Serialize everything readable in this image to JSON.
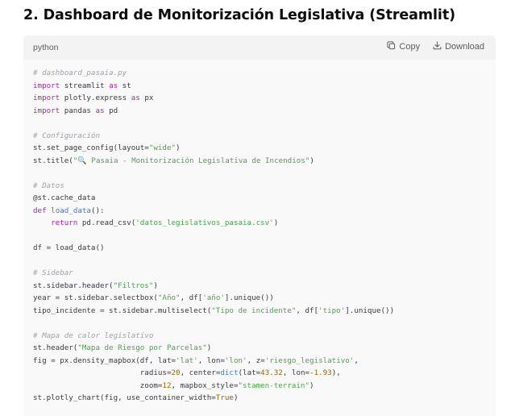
{
  "heading": "2. Dashboard de Monitorización Legislativa (Streamlit)",
  "code_block": {
    "language": "python",
    "copy_label": "Copy",
    "download_label": "Download",
    "copy_icon": "copy-icon",
    "download_icon": "download-icon",
    "lines": [
      [
        {
          "t": "comment",
          "v": "# dashboard_pasaia.py"
        }
      ],
      [
        {
          "t": "keyword",
          "v": "import"
        },
        {
          "t": "plain",
          "v": " streamlit "
        },
        {
          "t": "keyword",
          "v": "as"
        },
        {
          "t": "plain",
          "v": " st"
        }
      ],
      [
        {
          "t": "keyword",
          "v": "import"
        },
        {
          "t": "plain",
          "v": " plotly.express "
        },
        {
          "t": "keyword",
          "v": "as"
        },
        {
          "t": "plain",
          "v": " px"
        }
      ],
      [
        {
          "t": "keyword",
          "v": "import"
        },
        {
          "t": "plain",
          "v": " pandas "
        },
        {
          "t": "keyword",
          "v": "as"
        },
        {
          "t": "plain",
          "v": " pd"
        }
      ],
      [],
      [
        {
          "t": "comment",
          "v": "# Configuración"
        }
      ],
      [
        {
          "t": "plain",
          "v": "st.set_page_config(layout="
        },
        {
          "t": "string",
          "v": "\"wide\""
        },
        {
          "t": "plain",
          "v": ")"
        }
      ],
      [
        {
          "t": "plain",
          "v": "st.title("
        },
        {
          "t": "string",
          "v": "\"🔍 Pasaia - Monitorización Legislativa de Incendios\""
        },
        {
          "t": "plain",
          "v": ")"
        }
      ],
      [],
      [
        {
          "t": "comment",
          "v": "# Datos"
        }
      ],
      [
        {
          "t": "plain",
          "v": "@st.cache_data"
        }
      ],
      [
        {
          "t": "keyword",
          "v": "def"
        },
        {
          "t": "plain",
          "v": " "
        },
        {
          "t": "func",
          "v": "load_data"
        },
        {
          "t": "plain",
          "v": "():"
        }
      ],
      [
        {
          "t": "plain",
          "v": "    "
        },
        {
          "t": "keyword",
          "v": "return"
        },
        {
          "t": "plain",
          "v": " pd.read_csv("
        },
        {
          "t": "string",
          "v": "'datos_legislativos_pasaia.csv'"
        },
        {
          "t": "plain",
          "v": ")"
        }
      ],
      [],
      [
        {
          "t": "plain",
          "v": "df = load_data()"
        }
      ],
      [],
      [
        {
          "t": "comment",
          "v": "# Sidebar"
        }
      ],
      [
        {
          "t": "plain",
          "v": "st.sidebar.header("
        },
        {
          "t": "string",
          "v": "\"Filtros\""
        },
        {
          "t": "plain",
          "v": ")"
        }
      ],
      [
        {
          "t": "plain",
          "v": "year = st.sidebar.selectbox("
        },
        {
          "t": "string",
          "v": "\"Año\""
        },
        {
          "t": "plain",
          "v": ", df["
        },
        {
          "t": "string",
          "v": "'año'"
        },
        {
          "t": "plain",
          "v": "].unique())"
        }
      ],
      [
        {
          "t": "plain",
          "v": "tipo_incidente = st.sidebar.multiselect("
        },
        {
          "t": "string",
          "v": "\"Tipo de incidente\""
        },
        {
          "t": "plain",
          "v": ", df["
        },
        {
          "t": "string",
          "v": "'tipo'"
        },
        {
          "t": "plain",
          "v": "].unique())"
        }
      ],
      [],
      [
        {
          "t": "comment",
          "v": "# Mapa de calor legislativo"
        }
      ],
      [
        {
          "t": "plain",
          "v": "st.header("
        },
        {
          "t": "string",
          "v": "\"Mapa de Riesgo por Parcelas\""
        },
        {
          "t": "plain",
          "v": ")"
        }
      ],
      [
        {
          "t": "plain",
          "v": "fig = px.density_mapbox(df, lat="
        },
        {
          "t": "string",
          "v": "'lat'"
        },
        {
          "t": "plain",
          "v": ", lon="
        },
        {
          "t": "string",
          "v": "'lon'"
        },
        {
          "t": "plain",
          "v": ", z="
        },
        {
          "t": "string",
          "v": "'riesgo_legislativo'"
        },
        {
          "t": "plain",
          "v": ","
        }
      ],
      [
        {
          "t": "plain",
          "v": "                        radius="
        },
        {
          "t": "number",
          "v": "20"
        },
        {
          "t": "plain",
          "v": ", center="
        },
        {
          "t": "func",
          "v": "dict"
        },
        {
          "t": "plain",
          "v": "(lat="
        },
        {
          "t": "number",
          "v": "43.32"
        },
        {
          "t": "plain",
          "v": ", lon="
        },
        {
          "t": "number",
          "v": "-1.93"
        },
        {
          "t": "plain",
          "v": "),"
        }
      ],
      [
        {
          "t": "plain",
          "v": "                        zoom="
        },
        {
          "t": "number",
          "v": "12"
        },
        {
          "t": "plain",
          "v": ", mapbox_style="
        },
        {
          "t": "string",
          "v": "\"stamen-terrain\""
        },
        {
          "t": "plain",
          "v": ")"
        }
      ],
      [
        {
          "t": "plain",
          "v": "st.plotly_chart(fig, use_container_width="
        },
        {
          "t": "number",
          "v": "True"
        },
        {
          "t": "plain",
          "v": ")"
        }
      ]
    ]
  }
}
